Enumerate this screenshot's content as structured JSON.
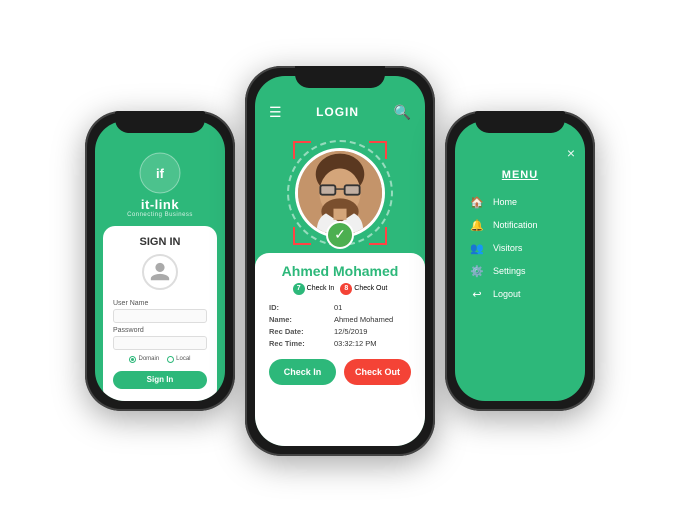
{
  "left_phone": {
    "brand": "it-link",
    "brand_sub": "Connecting Business",
    "sign_in_title": "SIGN IN",
    "username_label": "User Name",
    "password_label": "Password",
    "domain_label": "Domain",
    "local_label": "Local",
    "sign_in_button": "Sign In"
  },
  "center_phone": {
    "header_title": "LOGIN",
    "person_name": "Ahmed Mohamed",
    "check_in_badge": "Check In",
    "check_out_badge": "Check Out",
    "id_label": "ID:",
    "id_value": "01",
    "name_label": "Name:",
    "name_value": "Ahmed Mohamed",
    "rec_date_label": "Rec Date:",
    "rec_date_value": "12/5/2019",
    "rec_time_label": "Rec Time:",
    "rec_time_value": "03:32:12 PM",
    "check_in_button": "Check In",
    "check_out_button": "Check Out"
  },
  "right_phone": {
    "menu_title": "MENU",
    "close_label": "×",
    "items": [
      {
        "icon": "🏠",
        "label": "Home"
      },
      {
        "icon": "🔔",
        "label": "Notification"
      },
      {
        "icon": "👥",
        "label": "Visitors"
      },
      {
        "icon": "⚙️",
        "label": "Settings"
      },
      {
        "icon": "→",
        "label": "Logout"
      }
    ]
  },
  "colors": {
    "green": "#2db87a",
    "red": "#f44336",
    "dark": "#1a1a1a"
  }
}
